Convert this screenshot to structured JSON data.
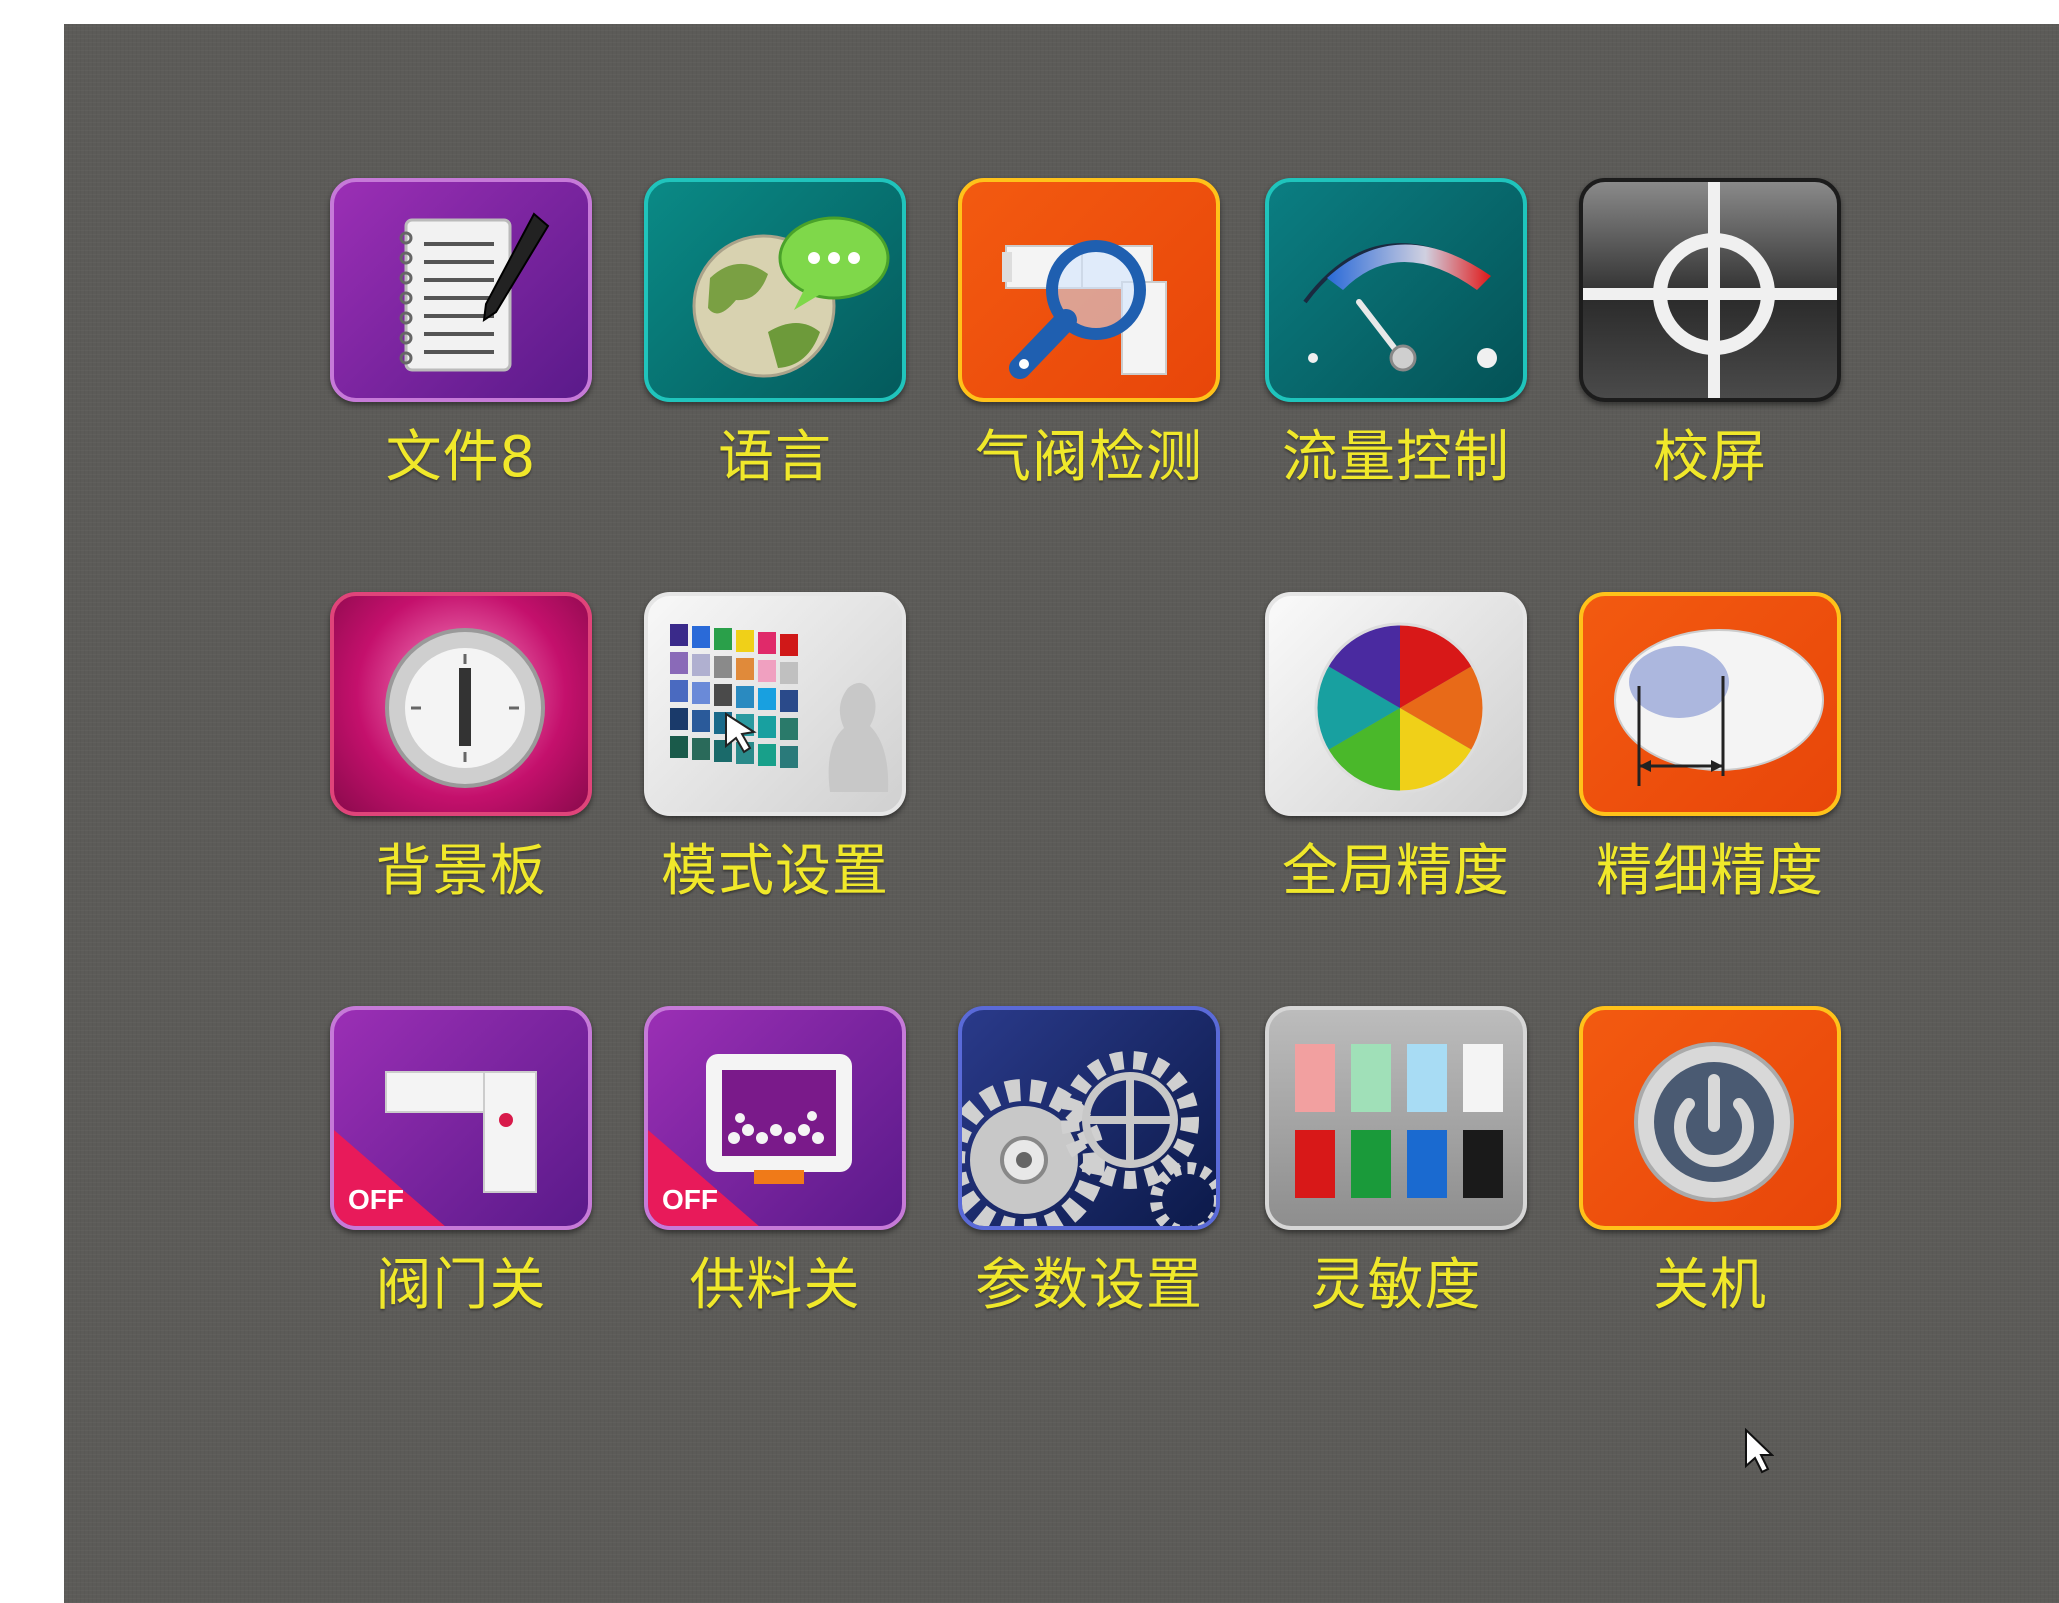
{
  "screen": {
    "background": "#5c5b58",
    "label_color": "#f0e82a"
  },
  "menu": {
    "items": [
      {
        "label": "文件8",
        "icon": "notepad-pen-icon"
      },
      {
        "label": "语言",
        "icon": "globe-chat-icon"
      },
      {
        "label": "气阀检测",
        "icon": "valve-magnifier-icon"
      },
      {
        "label": "流量控制",
        "icon": "gauge-icon"
      },
      {
        "label": "校屏",
        "icon": "crosshair-icon"
      },
      {
        "label": "背景板",
        "icon": "clock-dial-icon"
      },
      {
        "label": "模式设置",
        "icon": "color-grid-icon"
      },
      {
        "label": "全局精度",
        "icon": "color-wheel-icon"
      },
      {
        "label": "精细精度",
        "icon": "grain-measure-icon"
      },
      {
        "label": "阀门关",
        "icon": "valve-off-icon",
        "badge": "OFF"
      },
      {
        "label": "供料关",
        "icon": "feeder-off-icon",
        "badge": "OFF"
      },
      {
        "label": "参数设置",
        "icon": "gears-icon"
      },
      {
        "label": "灵敏度",
        "icon": "sensitivity-swatches-icon"
      },
      {
        "label": "关机",
        "icon": "power-icon"
      }
    ]
  }
}
